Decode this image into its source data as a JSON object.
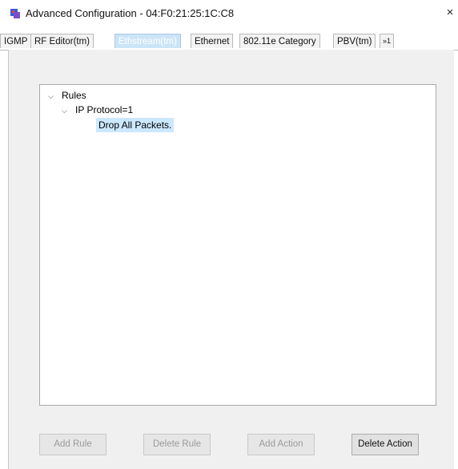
{
  "window": {
    "title": "Advanced Configuration - 04:F0:21:25:1C:C8",
    "close_glyph": "×",
    "icon": "app-config-icon"
  },
  "tabs": [
    {
      "label": "IGMP"
    },
    {
      "label": "RF Editor(tm)"
    },
    {
      "label": "Ethstream(tm)"
    },
    {
      "label": "Ethernet"
    },
    {
      "label": "802.11e Category"
    },
    {
      "label": "PBV(tm)"
    }
  ],
  "tabs_overflow_label": "»1",
  "tree": {
    "root": {
      "label": "Rules",
      "toggle": "⌵"
    },
    "child": {
      "label": "IP Protocol=1",
      "toggle": "⌵"
    },
    "leaf": {
      "label": "Drop All Packets."
    }
  },
  "buttons": {
    "add_rule": "Add Rule",
    "delete_rule": "Delete Rule",
    "add_action": "Add Action",
    "delete_action": "Delete Action"
  },
  "colors": {
    "selection": "#cce8ff",
    "active_tab": "#cce4f7"
  }
}
